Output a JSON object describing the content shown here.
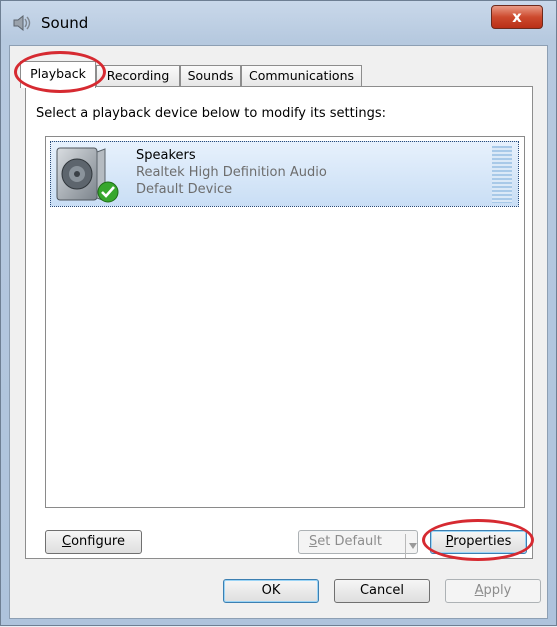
{
  "window": {
    "title": "Sound",
    "close_label": "x"
  },
  "tabs": [
    {
      "label": "Playback",
      "active": true
    },
    {
      "label": "Recording",
      "active": false
    },
    {
      "label": "Sounds",
      "active": false
    },
    {
      "label": "Communications",
      "active": false
    }
  ],
  "instruction": "Select a playback device below to modify its settings:",
  "devices": [
    {
      "name": "Speakers",
      "driver": "Realtek High Definition Audio",
      "status": "Default Device",
      "icon": "speaker-icon",
      "badge": "default-check-icon"
    }
  ],
  "panel_buttons": {
    "configure": {
      "accel": "C",
      "rest": "onfigure"
    },
    "set_default": {
      "accel": "S",
      "rest": "et Default"
    },
    "properties": {
      "accel": "P",
      "rest": "roperties"
    }
  },
  "dialog_buttons": {
    "ok": "OK",
    "cancel": "Cancel",
    "apply": {
      "accel": "A",
      "rest": "pply"
    }
  },
  "annotation_color": "#d62a31"
}
